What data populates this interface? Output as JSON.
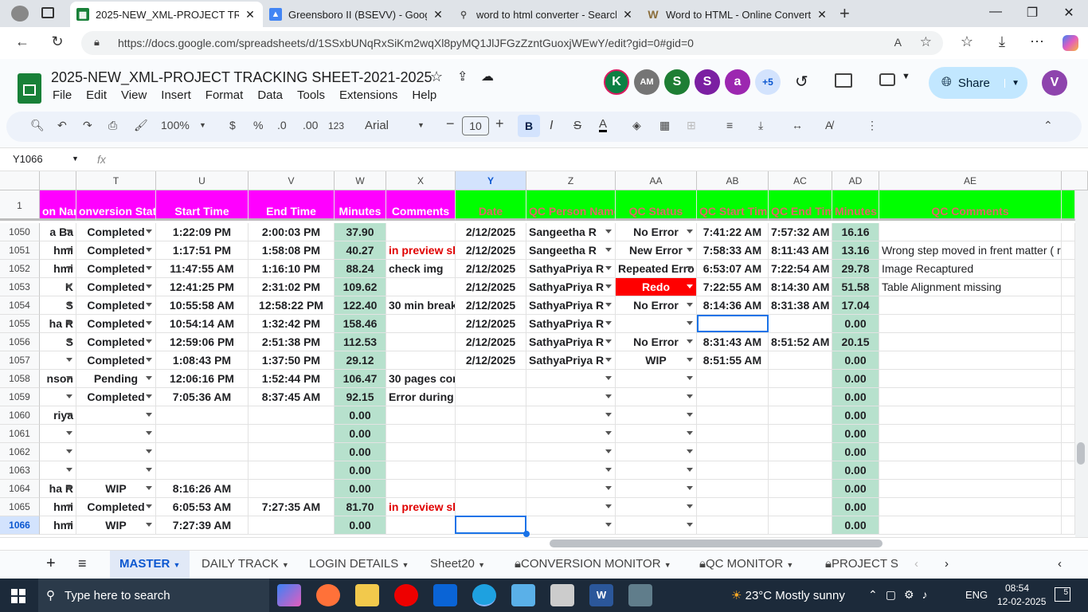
{
  "browser": {
    "tabs": [
      {
        "title": "2025-NEW_XML-PROJECT TRACK",
        "icon": "sheets-icon",
        "active": true
      },
      {
        "title": "Greensboro II (BSEVV) - Google D",
        "icon": "drive-icon"
      },
      {
        "title": "word to html converter - Search",
        "icon": "search-icon"
      },
      {
        "title": "Word to HTML - Online Converte",
        "icon": "w-icon"
      }
    ],
    "url": "https://docs.google.com/spreadsheets/d/1SSxbUNqRxSiKm2wqXl8pyMQ1JlJFGzZzntGuoxjWEwY/edit?gid=0#gid=0"
  },
  "doc": {
    "title": "2025-NEW_XML-PROJECT TRACKING SHEET-2021-2025",
    "menu": [
      "File",
      "Edit",
      "View",
      "Insert",
      "Format",
      "Data",
      "Tools",
      "Extensions",
      "Help"
    ],
    "avatars": [
      {
        "letter": "K",
        "color": "#0b8043"
      },
      {
        "letter": "AM",
        "color": "#757575"
      },
      {
        "letter": "S",
        "color": "#1e7e34"
      },
      {
        "letter": "S",
        "color": "#7b1fa2"
      },
      {
        "letter": "a",
        "color": "#9c27b0"
      },
      {
        "letter": "+5",
        "color": "#d3e3fd"
      }
    ],
    "share_label": "Share",
    "user_initial": "V",
    "user_color": "#8e44ad"
  },
  "toolbar": {
    "zoom": "100%",
    "currency": "$",
    "percent": "%",
    "dec_less": ".0",
    "dec_more": ".00",
    "format_num": "123",
    "font": "Arial",
    "font_size": "10"
  },
  "formula": {
    "name_box": "Y1066",
    "fx": "fx",
    "value": ""
  },
  "columns": [
    "T",
    "U",
    "V",
    "W",
    "X",
    "Y",
    "Z",
    "AA",
    "AB",
    "AC",
    "AD",
    "AE"
  ],
  "header_row": {
    "num": "1",
    "cells": [
      "on Nam",
      "onversion Statu",
      "Start Time",
      "End Time",
      "Minutes",
      "Comments",
      "Date",
      "QC Person Name",
      "QC Status",
      "QC Start Time",
      "QC End Time",
      "Minutes",
      "QC Comments"
    ]
  },
  "rows": [
    {
      "num": "1050",
      "c": [
        "a Ba",
        "Completed",
        "1:22:09 PM",
        "2:00:03 PM",
        "37.90",
        "",
        "2/12/2025",
        "Sangeetha R",
        "No Error",
        "7:41:22 AM",
        "7:57:32 AM",
        "16.16",
        ""
      ]
    },
    {
      "num": "1051",
      "c": [
        "hmi",
        "Completed",
        "1:17:51 PM",
        "1:58:08 PM",
        "40.27",
        "in preview sh",
        "2/12/2025",
        "Sangeetha R",
        "New Error",
        "7:58:33 AM",
        "8:11:43 AM",
        "13.16",
        "Wrong step moved in frent matter ( ref"
      ]
    },
    {
      "num": "1052",
      "c": [
        "hmi",
        "Completed",
        "11:47:55 AM",
        "1:16:10 PM",
        "88.24",
        "check img",
        "2/12/2025",
        "SathyaPriya R",
        "Repeated Erro",
        "6:53:07 AM",
        "7:22:54 AM",
        "29.78",
        "Image Recaptured"
      ]
    },
    {
      "num": "1053",
      "c": [
        "K",
        "Completed",
        "12:41:25 PM",
        "2:31:02 PM",
        "109.62",
        "",
        "2/12/2025",
        "SathyaPriya R",
        "Redo",
        "7:22:55 AM",
        "8:14:30 AM",
        "51.58",
        "Table Alignment missing"
      ]
    },
    {
      "num": "1054",
      "c": [
        "S",
        "Completed",
        "10:55:58 AM",
        "12:58:22 PM",
        "122.40",
        "30 min break",
        "2/12/2025",
        "SathyaPriya R",
        "No Error",
        "8:14:36 AM",
        "8:31:38 AM",
        "17.04",
        ""
      ]
    },
    {
      "num": "1055",
      "c": [
        "ha R",
        "Completed",
        "10:54:14 AM",
        "1:32:42 PM",
        "158.46",
        "",
        "2/12/2025",
        "SathyaPriya R",
        "",
        "",
        "",
        "0.00",
        ""
      ]
    },
    {
      "num": "1056",
      "c": [
        "S",
        "Completed",
        "12:59:06 PM",
        "2:51:38 PM",
        "112.53",
        "",
        "2/12/2025",
        "SathyaPriya R",
        "No Error",
        "8:31:43 AM",
        "8:51:52 AM",
        "20.15",
        ""
      ]
    },
    {
      "num": "1057",
      "c": [
        "",
        "Completed",
        "1:08:43 PM",
        "1:37:50 PM",
        "29.12",
        "",
        "2/12/2025",
        "SathyaPriya R",
        "WIP",
        "8:51:55 AM",
        "",
        "0.00",
        ""
      ]
    },
    {
      "num": "1058",
      "c": [
        "nson",
        "Pending",
        "12:06:16 PM",
        "1:52:44 PM",
        "106.47",
        "30 pages con",
        "",
        "",
        "",
        "",
        "",
        "0.00",
        ""
      ]
    },
    {
      "num": "1059",
      "c": [
        "",
        "Completed",
        "7:05:36 AM",
        "8:37:45 AM",
        "92.15",
        "Error during ru",
        "",
        "",
        "",
        "",
        "",
        "0.00",
        ""
      ]
    },
    {
      "num": "1060",
      "c": [
        "riya",
        "",
        "",
        "",
        "0.00",
        "",
        "",
        "",
        "",
        "",
        "",
        "0.00",
        ""
      ]
    },
    {
      "num": "1061",
      "c": [
        "",
        "",
        "",
        "",
        "0.00",
        "",
        "",
        "",
        "",
        "",
        "",
        "0.00",
        ""
      ]
    },
    {
      "num": "1062",
      "c": [
        "",
        "",
        "",
        "",
        "0.00",
        "",
        "",
        "",
        "",
        "",
        "",
        "0.00",
        ""
      ]
    },
    {
      "num": "1063",
      "c": [
        "",
        "",
        "",
        "",
        "0.00",
        "",
        "",
        "",
        "",
        "",
        "",
        "0.00",
        ""
      ]
    },
    {
      "num": "1064",
      "c": [
        "ha R",
        "WIP",
        "8:16:26 AM",
        "",
        "0.00",
        "",
        "",
        "",
        "",
        "",
        "",
        "0.00",
        ""
      ]
    },
    {
      "num": "1065",
      "c": [
        "hmi",
        "Completed",
        "6:05:53 AM",
        "7:27:35 AM",
        "81.70",
        "in preview sh",
        "",
        "",
        "",
        "",
        "",
        "0.00",
        ""
      ]
    },
    {
      "num": "1066",
      "c": [
        "hmi",
        "WIP",
        "7:27:39 AM",
        "",
        "0.00",
        "",
        "",
        "",
        "",
        "",
        "",
        "0.00",
        ""
      ]
    }
  ],
  "sheet_tabs": [
    "MASTER",
    "DAILY TRACK",
    "LOGIN DETAILS",
    "Sheet20",
    "CONVERSION MONITOR",
    "QC MONITOR",
    "PROJECT S"
  ],
  "taskbar": {
    "search": "Type here to search",
    "weather": "23°C  Mostly sunny",
    "lang": "ENG",
    "time": "08:54",
    "date": "12-02-2025",
    "notif": "5"
  }
}
